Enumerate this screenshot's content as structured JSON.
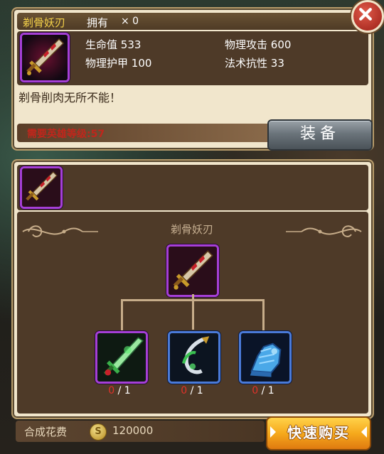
{
  "item": {
    "name": "剃骨妖刃",
    "own_label": "拥有",
    "own_count": "× 0",
    "description": "剃骨削肉无所不能！",
    "requirement": "需要英雄等级:57",
    "icon": "demon-blade-icon"
  },
  "stats": [
    {
      "label": "生命值",
      "value": "533"
    },
    {
      "label": "物理攻击",
      "value": "600"
    },
    {
      "label": "物理护甲",
      "value": "100"
    },
    {
      "label": "法术抗性",
      "value": "33"
    }
  ],
  "buttons": {
    "equip": "装备",
    "close_icon": "close-icon",
    "quick_buy": "快速购买"
  },
  "craft": {
    "title": "剃骨妖刃",
    "components": [
      {
        "icon": "green-sword-icon",
        "have": "0",
        "need": "/ 1",
        "frame": "purple"
      },
      {
        "icon": "curved-dagger-icon",
        "have": "0",
        "need": "/ 1",
        "frame": "blue"
      },
      {
        "icon": "blue-gauntlet-icon",
        "have": "0",
        "need": "/ 1",
        "frame": "blue"
      }
    ],
    "cost_label": "合成花费",
    "cost_value": "120000",
    "coin_symbol": "S"
  },
  "colors": {
    "item_name": "#f5d24a",
    "requirement": "#c0261c",
    "purple_frame": "#a53fd6",
    "blue_frame": "#4a7ad8",
    "buy_button": "#f6a91c"
  }
}
